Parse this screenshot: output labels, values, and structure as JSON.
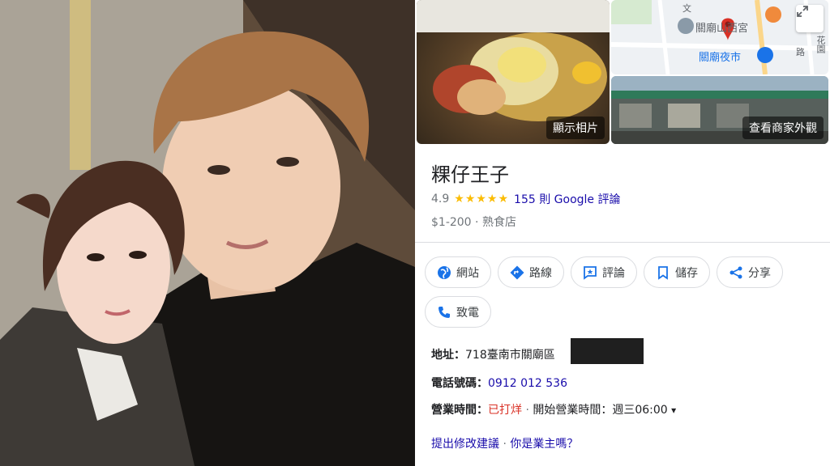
{
  "photo": {
    "alt_name": "couple-selfie-photo"
  },
  "place": {
    "name": "粿仔王子",
    "rating": "4.9",
    "stars": "★★★★★",
    "review_text": "155 則 Google 評論",
    "price": "$1-200",
    "category_sep": " · ",
    "category": "熟食店"
  },
  "thumbs": {
    "food_label": "顯示相片",
    "street_label": "查看商家外觀",
    "map": {
      "poi_temple": "關廟山西宮",
      "poi_market": "關廟夜市",
      "road_1": "文",
      "road_2": "花園",
      "road_3": "路"
    }
  },
  "actions": [
    {
      "label": "網站",
      "icon": "globe-icon"
    },
    {
      "label": "路線",
      "icon": "directions-icon"
    },
    {
      "label": "評論",
      "icon": "review-icon"
    },
    {
      "label": "儲存",
      "icon": "bookmark-icon"
    },
    {
      "label": "分享",
      "icon": "share-icon"
    },
    {
      "label": "致電",
      "icon": "phone-icon"
    }
  ],
  "details": {
    "address_label": "地址：",
    "address_value": "718臺南市關廟區",
    "phone_label": "電話號碼：",
    "phone_value": "0912 012 536",
    "hours_label": "營業時間：",
    "hours_status": "已打烊",
    "hours_sep": " · ",
    "hours_value": "開始營業時間：週三06:00",
    "hours_toggle": "▾"
  },
  "footer": {
    "suggest_edit": "提出修改建議",
    "sep": " · ",
    "owner": "你是業主嗎？"
  },
  "colors": {
    "link": "#1a0dab",
    "star": "#fbbc04",
    "closed": "#d93025",
    "accent": "#1a73e8"
  }
}
